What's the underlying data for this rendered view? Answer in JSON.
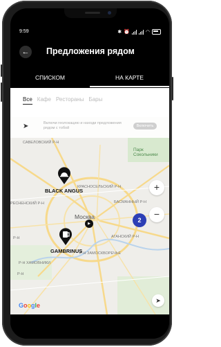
{
  "status_bar": {
    "time": "9:59"
  },
  "header": {
    "title": "Предложения рядом",
    "back_icon": "arrow-left-icon"
  },
  "tabs": [
    {
      "label": "СПИСКОМ"
    },
    {
      "label": "НА КАРТЕ"
    }
  ],
  "filters": [
    {
      "label": "Все",
      "active": true
    },
    {
      "label": "Кафе",
      "active": false
    },
    {
      "label": "Рестораны",
      "active": false
    },
    {
      "label": "Бары",
      "active": false
    }
  ],
  "geo_bar": {
    "text": "Включи геолокацию и находи предложения рядом с тобой",
    "button": "Включить"
  },
  "map": {
    "city_label": "Москва",
    "labels": {
      "savelovsky": "САВЕЛОВСКИЙ Р-Н",
      "park": "Парк Сокольники",
      "krasnoselsky": "КРАСНОСЕЛЬСКИЙ Р-Н",
      "presnensky": "РЕСНЕНСКИЙ Р-Н",
      "basmanny": "БАСМАННЫЙ Р-Н",
      "tagansky": "АГАНСКИЙ Р-Н",
      "zamoskvorechye": "Р-Н ЗАМОСКВОРЕЧЬЕ",
      "khamovniki": "Р-Н ХАМОВНИКИ",
      "rn_left": "Р-Н",
      "rn_left2": "Р-Н"
    },
    "pins": [
      {
        "label": "BLACK ANGUS"
      },
      {
        "label": "GAMBRINUS"
      }
    ],
    "cluster_count": "2",
    "zoom_in": "+",
    "zoom_out": "−",
    "attribution": "Google"
  },
  "colors": {
    "accent_cluster": "#2d3fb5",
    "header_bg": "#000000",
    "road_yellow": "#f7d98b"
  }
}
